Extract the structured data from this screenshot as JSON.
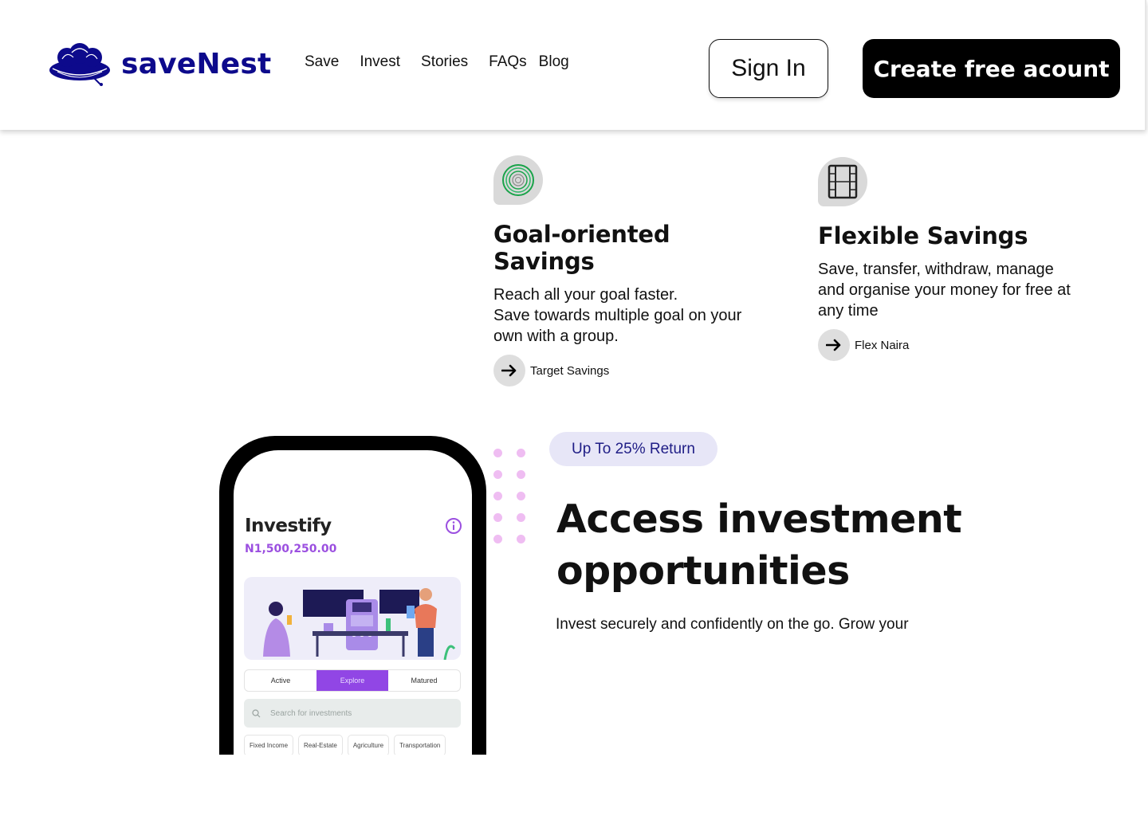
{
  "brand": {
    "name": "saveNest",
    "color": "#0d0a8c"
  },
  "nav": {
    "items": [
      {
        "label": "Save"
      },
      {
        "label": "Invest"
      },
      {
        "label": "Stories"
      },
      {
        "label": "FAQs"
      },
      {
        "label": "Blog"
      }
    ]
  },
  "header": {
    "signin_label": "Sign In",
    "create_label": "Create free acount"
  },
  "features": [
    {
      "icon": "target-rings-icon",
      "title": "Goal-oriented Savings",
      "description": "Reach all your goal faster.\nSave towards multiple goal on your own with a group.",
      "link_label": "Target Savings"
    },
    {
      "icon": "film-strip-icon",
      "title": "Flexible Savings",
      "description": "Save, transfer, withdraw, manage and organise your money for free at any time",
      "link_label": "Flex Naira"
    }
  ],
  "phone": {
    "app_title": "Investify",
    "balance": "N1,500,250.00",
    "tabs": [
      {
        "label": "Active"
      },
      {
        "label": "Explore",
        "active": true
      },
      {
        "label": "Matured"
      }
    ],
    "search_placeholder": "Search for investments",
    "categories": [
      "Fixed Income",
      "Real-Estate",
      "Agriculture",
      "Transportation"
    ]
  },
  "invest": {
    "badge": "Up To 25% Return",
    "heading": "Access investment opportunities",
    "text": "Invest securely and confidently on the go. Grow your"
  },
  "colors": {
    "accent_purple": "#9146e5",
    "badge_bg": "#e7e6f7",
    "dot_pink": "#efbdf2"
  }
}
